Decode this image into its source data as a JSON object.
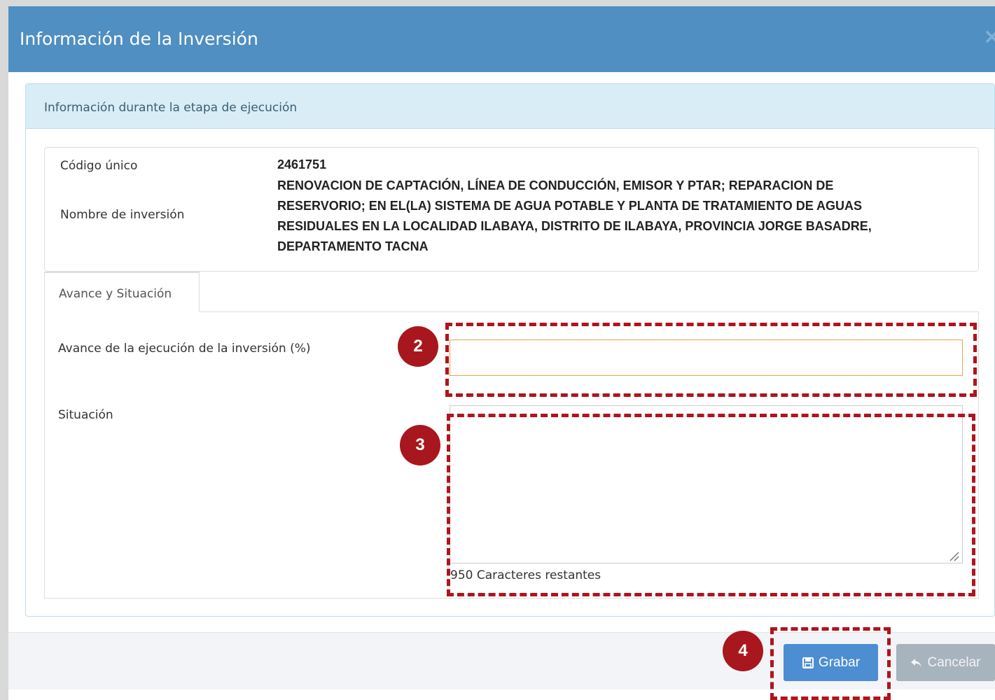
{
  "modal": {
    "title": "Información de la Inversión",
    "close_glyph": "×"
  },
  "panel": {
    "heading": "Información durante la etapa de ejecución"
  },
  "info": {
    "codigo_label": "Código único",
    "codigo_value": "2461751",
    "nombre_label": "Nombre de inversión",
    "nombre_lines": [
      "RENOVACION DE CAPTACIÓN, LÍNEA DE CONDUCCIÓN, EMISOR Y PTAR; REPARACION DE",
      "RESERVORIO; EN EL(LA) SISTEMA DE AGUA POTABLE Y PLANTA DE TRATAMIENTO DE AGUAS",
      "RESIDUALES EN LA LOCALIDAD ILABAYA, DISTRITO DE ILABAYA, PROVINCIA JORGE BASADRE,",
      "DEPARTAMENTO TACNA"
    ]
  },
  "tabs": [
    {
      "label": "Avance y Situación",
      "active": true
    }
  ],
  "form": {
    "avance_label": "Avance de la ejecución de la inversión (%)",
    "avance_value": "",
    "situacion_label": "Situación",
    "situacion_value": "",
    "char_count": "950 Caracteres restantes"
  },
  "footer": {
    "grabar_label": "Grabar",
    "cancelar_label": "Cancelar"
  },
  "annotations": [
    {
      "number": "2"
    },
    {
      "number": "3"
    },
    {
      "number": "4"
    }
  ],
  "colors": {
    "header": "#4f8fc2",
    "annotation": "#b0141c",
    "grabar": "#4d8ed2",
    "cancelar": "#a7b3bd",
    "input_focus_border": "#f0a043"
  }
}
